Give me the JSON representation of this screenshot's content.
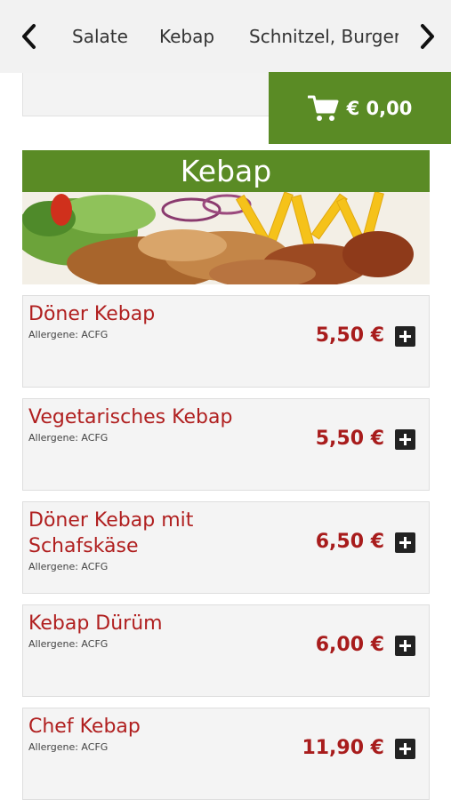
{
  "nav": {
    "categories": [
      "Salate",
      "Kebap",
      "Schnitzel, Burger &"
    ]
  },
  "cart": {
    "total": "€ 0,00",
    "icon": "shopping-cart-icon"
  },
  "section": {
    "title": "Kebap"
  },
  "items": [
    {
      "name": "Döner Kebap",
      "allergens": "Allergene: ACFG",
      "price": "5,50 €"
    },
    {
      "name": "Vegetarisches Kebap",
      "allergens": "Allergene: ACFG",
      "price": "5,50 €"
    },
    {
      "name": "Döner Kebap mit Schafskäse",
      "allergens": "Allergene: ACFG",
      "price": "6,50 €"
    },
    {
      "name": "Kebap Dürüm",
      "allergens": "Allergene: ACFG",
      "price": "6,00 €"
    },
    {
      "name": "Chef Kebap",
      "allergens": "Allergene: ACFG",
      "price": "11,90 €"
    }
  ],
  "colors": {
    "accent_green": "#5a8b25",
    "item_name_red": "#b01f1f",
    "price_red": "#a81c1c"
  }
}
